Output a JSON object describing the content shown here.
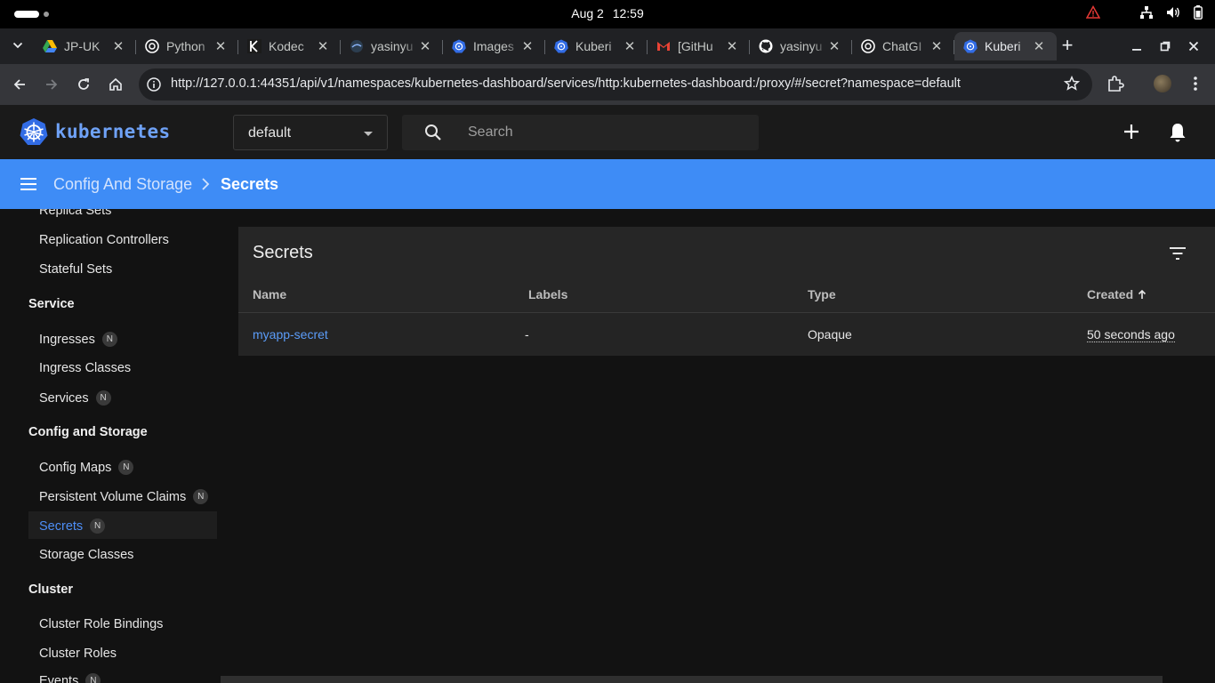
{
  "os": {
    "date": "Aug 2",
    "time": "12:59"
  },
  "browser": {
    "tabs": [
      {
        "title": "JP-UK",
        "icon": "google-drive-icon"
      },
      {
        "title": "Python",
        "icon": "chatgpt-icon"
      },
      {
        "title": "Kodec",
        "icon": "kodekloud-icon"
      },
      {
        "title": "yasinyu",
        "icon": "docker-icon"
      },
      {
        "title": "Images",
        "icon": "kubernetes-icon"
      },
      {
        "title": "Kuberi",
        "icon": "kubernetes-icon"
      },
      {
        "title": "[GitHu",
        "icon": "gmail-icon"
      },
      {
        "title": "yasinyu",
        "icon": "github-icon"
      },
      {
        "title": "ChatGI",
        "icon": "chatgpt-icon"
      },
      {
        "title": "Kuberi",
        "icon": "kubernetes-icon",
        "active": true
      }
    ],
    "url": "http://127.0.0.1:44351/api/v1/namespaces/kubernetes-dashboard/services/http:kubernetes-dashboard:/proxy/#/secret?namespace=default"
  },
  "header": {
    "logo_text": "kubernetes",
    "namespace": "default",
    "search_placeholder": "Search"
  },
  "breadcrumb": {
    "parent": "Config And Storage",
    "current": "Secrets"
  },
  "sidebar": {
    "items": [
      {
        "label": "Replica Sets",
        "type": "item"
      },
      {
        "label": "Replication Controllers",
        "type": "item"
      },
      {
        "label": "Stateful Sets",
        "type": "item"
      },
      {
        "label": "Service",
        "type": "section"
      },
      {
        "label": "Ingresses",
        "type": "item",
        "badge": "N"
      },
      {
        "label": "Ingress Classes",
        "type": "item"
      },
      {
        "label": "Services",
        "type": "item",
        "badge": "N"
      },
      {
        "label": "Config and Storage",
        "type": "section"
      },
      {
        "label": "Config Maps",
        "type": "item",
        "badge": "N"
      },
      {
        "label": "Persistent Volume Claims",
        "type": "item",
        "badge": "N"
      },
      {
        "label": "Secrets",
        "type": "item",
        "badge": "N",
        "active": true
      },
      {
        "label": "Storage Classes",
        "type": "item"
      },
      {
        "label": "Cluster",
        "type": "section"
      },
      {
        "label": "Cluster Role Bindings",
        "type": "item"
      },
      {
        "label": "Cluster Roles",
        "type": "item"
      },
      {
        "label": "Events",
        "type": "item",
        "badge": "N"
      }
    ]
  },
  "card": {
    "title": "Secrets",
    "columns": [
      "Name",
      "Labels",
      "Type",
      "Created"
    ],
    "sort_column": "Created",
    "rows": [
      {
        "name": "myapp-secret",
        "labels": "-",
        "type": "Opaque",
        "created": "50 seconds ago"
      }
    ]
  },
  "colors": {
    "accent": "#3e8cf6",
    "link": "#5b9cf8",
    "logo": "#326ce5"
  }
}
